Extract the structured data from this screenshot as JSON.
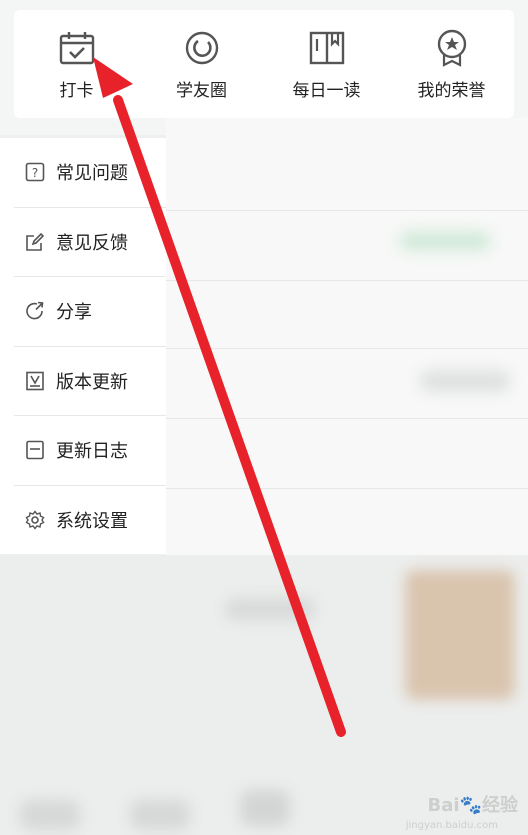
{
  "top_menu": {
    "items": [
      {
        "label": "打卡",
        "icon": "calendar-check-icon"
      },
      {
        "label": "学友圈",
        "icon": "circle-refresh-icon"
      },
      {
        "label": "每日一读",
        "icon": "book-icon"
      },
      {
        "label": "我的荣誉",
        "icon": "medal-icon"
      }
    ]
  },
  "side_menu": {
    "items": [
      {
        "label": "常见问题",
        "icon": "question-icon"
      },
      {
        "label": "意见反馈",
        "icon": "edit-icon"
      },
      {
        "label": "分享",
        "icon": "share-icon"
      },
      {
        "label": "版本更新",
        "icon": "version-icon"
      },
      {
        "label": "更新日志",
        "icon": "log-icon"
      },
      {
        "label": "系统设置",
        "icon": "gear-icon"
      }
    ]
  },
  "annotation": {
    "color": "#e8222b"
  },
  "watermark": {
    "text": "Bai 经验",
    "sub": "jingyan.baidu.com"
  }
}
